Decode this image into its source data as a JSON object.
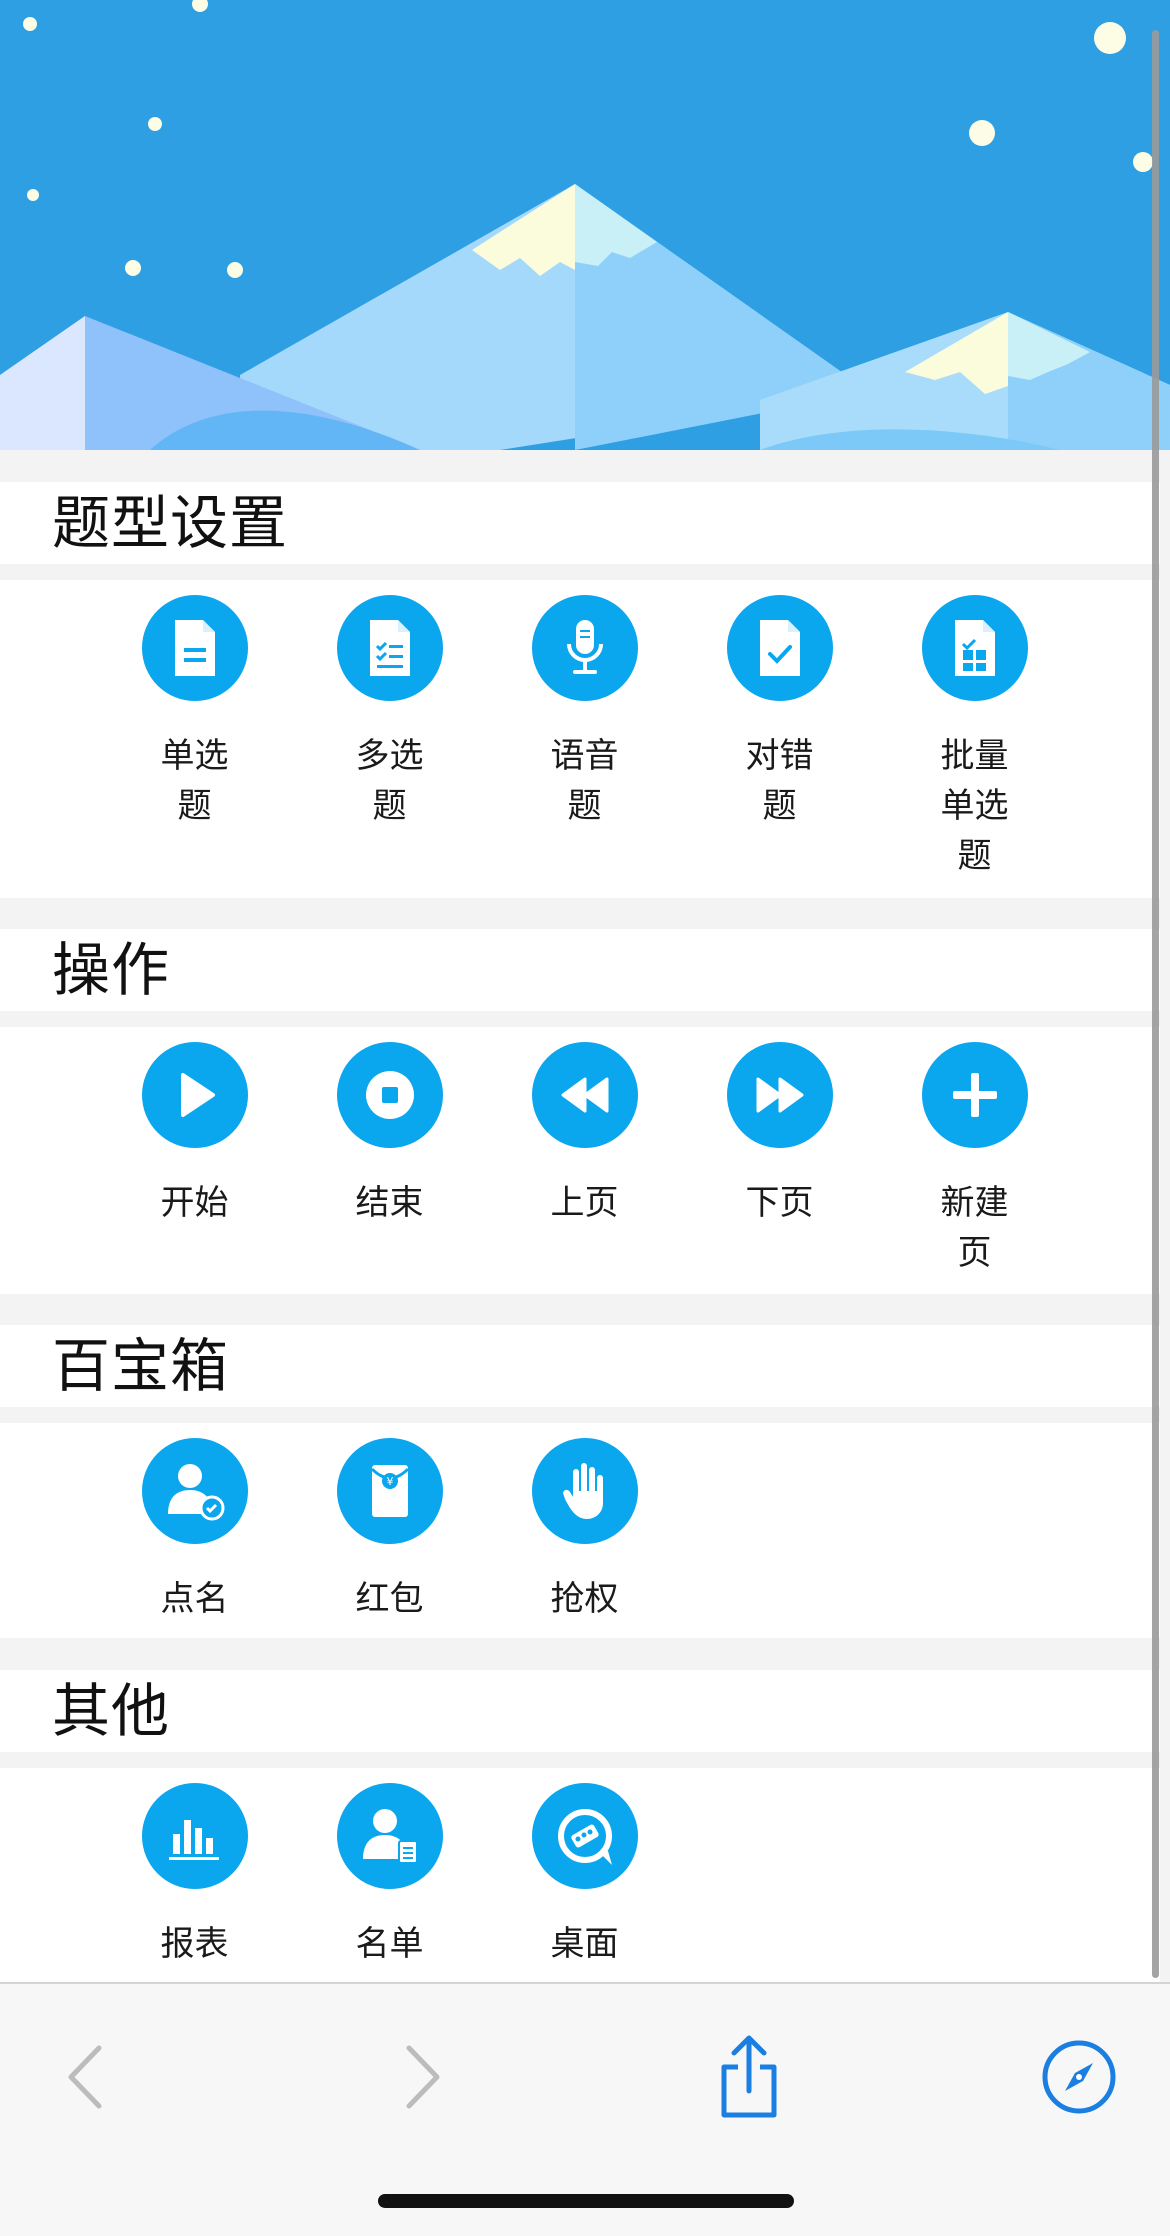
{
  "sections": [
    {
      "title": "题型设置",
      "items": [
        {
          "label": "单选题",
          "icon": "single-choice-icon"
        },
        {
          "label": "多选题",
          "icon": "multiple-choice-icon"
        },
        {
          "label": "语音题",
          "icon": "microphone-icon"
        },
        {
          "label": "对错题",
          "icon": "true-false-icon"
        },
        {
          "label": "批量单选题",
          "icon": "batch-single-choice-icon"
        }
      ]
    },
    {
      "title": "操作",
      "items": [
        {
          "label": "开始",
          "icon": "play-icon"
        },
        {
          "label": "结束",
          "icon": "stop-icon"
        },
        {
          "label": "上页",
          "icon": "rewind-icon"
        },
        {
          "label": "下页",
          "icon": "fast-forward-icon"
        },
        {
          "label": "新建页",
          "icon": "plus-icon"
        }
      ]
    },
    {
      "title": "百宝箱",
      "items": [
        {
          "label": "点名",
          "icon": "roll-call-icon"
        },
        {
          "label": "红包",
          "icon": "red-packet-icon"
        },
        {
          "label": "抢权",
          "icon": "raise-hand-icon"
        }
      ]
    },
    {
      "title": "其他",
      "items": [
        {
          "label": "报表",
          "icon": "bar-chart-icon"
        },
        {
          "label": "名单",
          "icon": "roster-icon"
        },
        {
          "label": "桌面",
          "icon": "desktop-icon"
        }
      ]
    }
  ],
  "toolbar": {
    "back": "chevron-left-icon",
    "forward": "chevron-right-icon",
    "share": "share-icon",
    "safari": "compass-icon"
  },
  "colors": {
    "accent": "#0aa6ee",
    "sky": "#2e9fe2",
    "toolbar_icon": "#1a7fe0",
    "toolbar_disabled": "#bcbcbc"
  }
}
